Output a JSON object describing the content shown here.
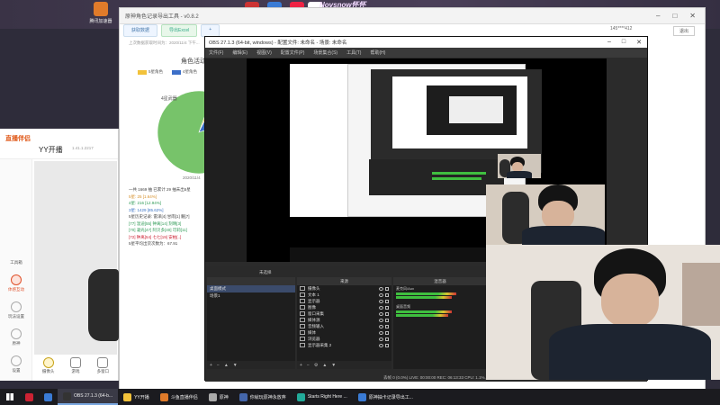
{
  "desktop": {
    "brand_banner": "Novsnow怀怀",
    "icons": [
      {
        "label": "腾讯加速器",
        "color": "#e07b2a"
      }
    ]
  },
  "stats_window": {
    "title": "原神角色记录导出工具 - v0.8.2",
    "tabs": [
      "获取数据",
      "导出Excel",
      "+"
    ],
    "address": "145****412",
    "exit_button": "退出",
    "note": "上次数据获取时间为：2020/11/4 下午...",
    "pie_title": "角色活动",
    "legend": [
      {
        "label": "5星角色",
        "color": "#f2c23a"
      },
      {
        "label": "4星角色",
        "color": "#3c6fc8"
      },
      {
        "label": "3星",
        "color": "#77c36a"
      }
    ],
    "pie_label": "4星武器",
    "pie_date": "2020/11/4",
    "stat_lines": [
      {
        "text": "一共 1669 抽 已累计 29 抽未出5星",
        "cls": ""
      },
      {
        "text": "5星: 25  [1.64%]",
        "cls": "o"
      },
      {
        "text": "4星: 216  [12.94%]",
        "cls": "g"
      },
      {
        "text": "3星: 1429  [85.62%]",
        "cls": "b"
      },
      {
        "text": "5星历史记录: 雷泽[4] 甘雨[1] 魈[7]",
        "cls": ""
      },
      {
        "text": "[77] 温迪[55] 钟离[14] 刻晴[3]",
        "cls": "g"
      },
      {
        "text": "[70] 凝光[47] 阿贝多[40] 可莉[11]",
        "cls": "g"
      },
      {
        "text": "[72] 钟离[54] 七七[19] 安柏[..]",
        "cls": "r"
      },
      {
        "text": "5星平均出货次数为：67.91",
        "cls": ""
      }
    ],
    "chart_data": {
      "type": "pie",
      "title": "角色活动",
      "categories": [
        "5星角色",
        "4星角色",
        "3星"
      ],
      "values": [
        1.64,
        12.94,
        85.62
      ]
    }
  },
  "yy_window": {
    "logo": "直播伴侣",
    "title": "YY开播",
    "version": "1.41.1.2217",
    "sidebar": [
      {
        "label": "工具箱",
        "active": false
      },
      {
        "label": "体感互动",
        "active": true
      },
      {
        "label": "玩法设置",
        "active": false
      },
      {
        "label": "原神",
        "active": false
      },
      {
        "label": "设置",
        "active": false
      }
    ],
    "bottom_buttons": [
      "摄像头",
      "游戏",
      "多窗口"
    ]
  },
  "obs_window": {
    "title": "OBS 27.1.3 (64-bit, windows) - 配置文件: 未命名 - 场景: 未命名",
    "menu": [
      "文件(F)",
      "编辑(E)",
      "视图(V)",
      "配置文件(P)",
      "场景集合(S)",
      "工具(T)",
      "帮助(H)"
    ],
    "scene_dropdown": "未选择",
    "panels": {
      "scenes_header": "",
      "sources_header": "来源",
      "mixer_header": "混音器"
    },
    "scenes": [
      "桌面模式",
      "场景1"
    ],
    "sources": [
      "摄像头",
      "文本 1",
      "显示器",
      "图像",
      "窗口采集",
      "媒体源",
      "音频输入",
      "媒体",
      "浏览器",
      "显示器采集 2"
    ],
    "mixer": [
      {
        "label": "麦克风/Aux",
        "level": 0.7
      },
      {
        "label": "桌面音频",
        "level": 0.65
      }
    ],
    "status": "丢帧 0 (0.0%)  LIVE: 00:00:00  REC: 06:13:33  CPU: 1.1%, 30.00 fps"
  },
  "taskbar": {
    "items": [
      {
        "label": "",
        "color": "#c23"
      },
      {
        "label": "",
        "color": "#3a7bd5"
      },
      {
        "label": "OBS 27.1.3 (64-b...",
        "color": "#333"
      },
      {
        "label": "YY开播",
        "color": "#f2c23a"
      },
      {
        "label": "斗鱼直播伴侣",
        "color": "#e07b2a"
      },
      {
        "label": "原神",
        "color": "#aaa"
      },
      {
        "label": "你就玩原神永放弃",
        "color": "#46a"
      },
      {
        "label": "Starts Right Here ...",
        "color": "#2a9"
      },
      {
        "label": "原神抽卡记录导出工...",
        "color": "#3a7bd5"
      }
    ]
  }
}
